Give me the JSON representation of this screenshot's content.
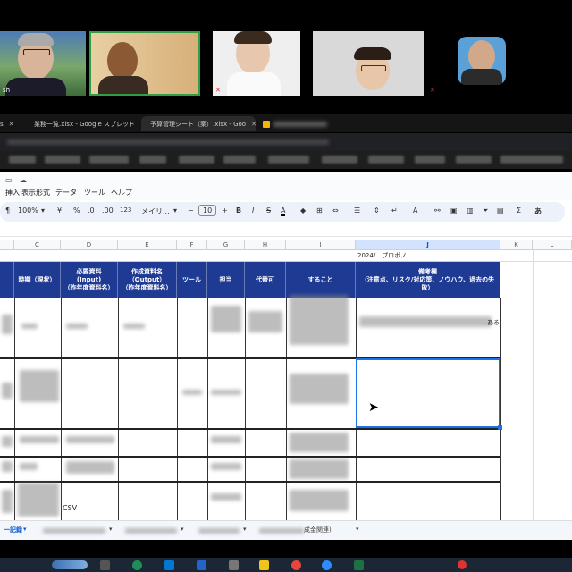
{
  "video_tiles": [
    {
      "name": "sh",
      "mic_muted": false
    },
    {
      "name": "",
      "mic_muted": false
    },
    {
      "name": "",
      "mic_muted": true
    },
    {
      "name": "",
      "mic_muted": false
    },
    {
      "name": "",
      "mic_muted": true
    }
  ],
  "browser": {
    "tabs": [
      {
        "label": "s"
      },
      {
        "label": "業務一覧.xlsx - Google スプレッド"
      },
      {
        "label": "予算管理シート（案）.xlsx - Goo"
      },
      {
        "label": ""
      }
    ]
  },
  "sheets": {
    "menu": [
      "挿入",
      "表示形式",
      "データ",
      "ツール",
      "ヘルプ"
    ],
    "toolbar": {
      "zoom": "100%",
      "currency": "¥",
      "percent": "%",
      "dec_minus": ".0",
      "dec_plus": ".00",
      "number_format": "123",
      "font": "メイリ...",
      "font_size": "10",
      "bold": "B",
      "italic": "I",
      "strike": "S",
      "text_color": "A",
      "link_icon": "link-icon",
      "comment_icon": "comment-icon",
      "chart_icon": "chart-icon",
      "filter_icon": "filter-icon",
      "sum": "Σ",
      "input_tool": "あ"
    },
    "columns": [
      "C",
      "D",
      "E",
      "F",
      "G",
      "H",
      "I",
      "J",
      "K",
      "L"
    ],
    "cell_j_top": "2024/　プロポノ",
    "headers": {
      "c": "時期（現状）",
      "d": "必要資料\n(Input)\n（昨年度資料名）",
      "e": "作成資料名\n（Output）\n（昨年度資料名）",
      "f": "ツール",
      "g": "担当",
      "h": "代替可",
      "i": "すること",
      "j": "備考欄\n（注意点、リスク/対応策、ノウハウ、過去の失敗）"
    },
    "cells": {
      "d_csv": "CSV",
      "j_row1_tail": "ある"
    },
    "sheet_tabs": [
      "一記録",
      "",
      "",
      "",
      "",
      "成金関連)"
    ]
  },
  "colors": {
    "header_bg": "#1f3a93",
    "selection": "#1a73e8",
    "active_tile_border": "#2f9e44"
  }
}
